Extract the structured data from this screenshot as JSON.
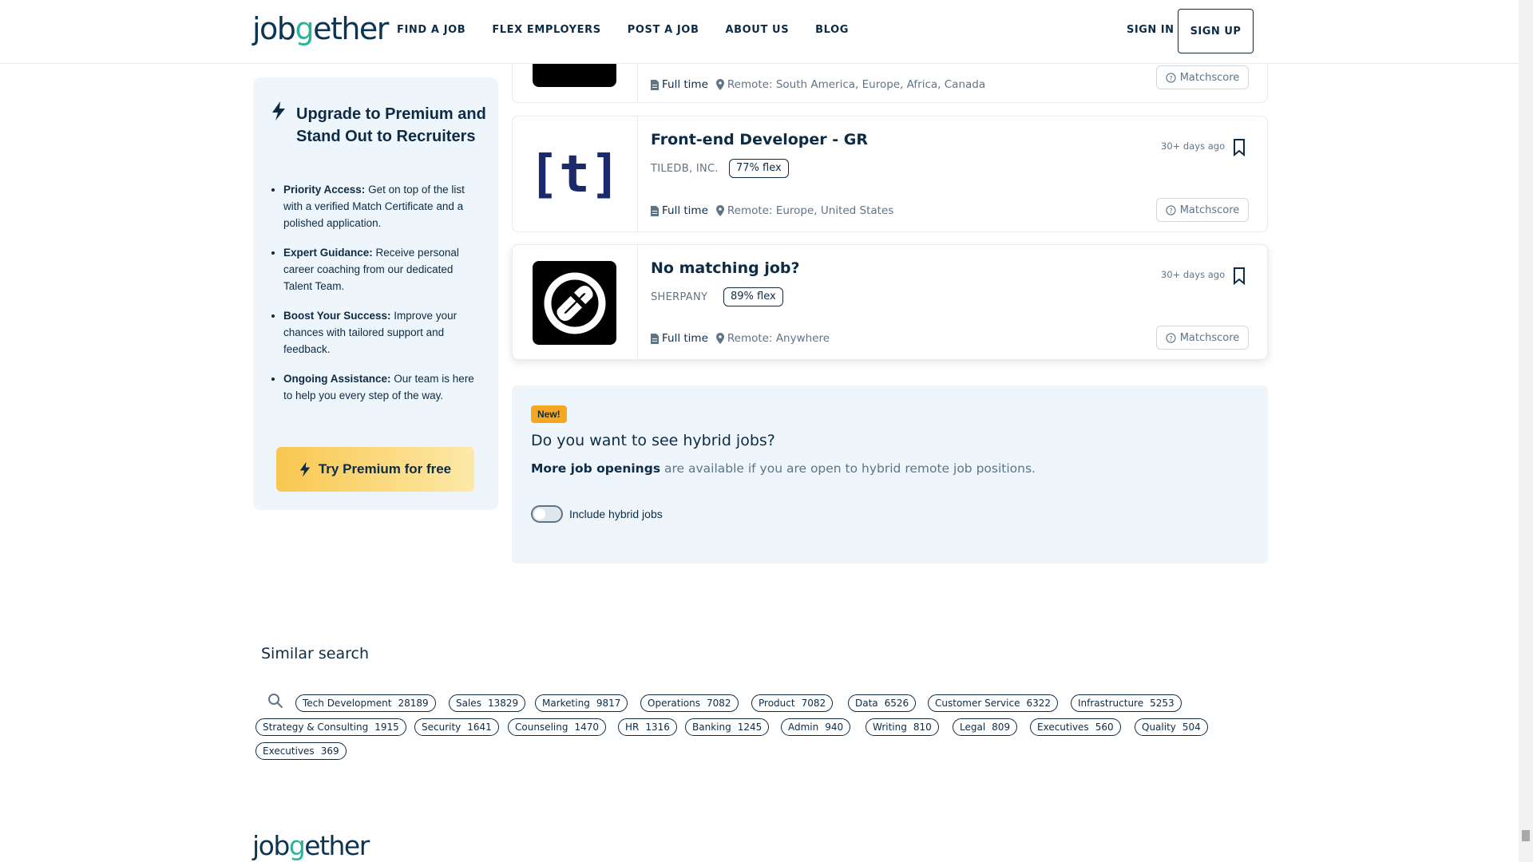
{
  "header": {
    "logo_pre": "job",
    "logo_g": "g",
    "logo_post": "ether",
    "nav": [
      "FIND A JOB",
      "FLEX EMPLOYERS",
      "POST A JOB",
      "ABOUT US",
      "BLOG"
    ],
    "sign_in": "SIGN IN",
    "sign_up": "SIGN UP"
  },
  "premium": {
    "title": "Upgrade to Premium and Stand Out to Recruiters",
    "items": [
      {
        "bold": "Priority Access:",
        "text": " Get on top of the list with a verified Match Certificate and a polished application."
      },
      {
        "bold": "Expert Guidance:",
        "text": " Receive personal career coaching from our dedicated Talent Team."
      },
      {
        "bold": "Boost Your Success:",
        "text": " Improve your chances with tailored support and feedback."
      },
      {
        "bold": "Ongoing Assistance:",
        "text": " Our team is here to help you every step of the way."
      }
    ],
    "cta": "Try Premium for free"
  },
  "jobs": [
    {
      "title": "",
      "company": "",
      "flex": "",
      "type": "Full time",
      "location": "Remote: South America, Europe, Africa, Canada",
      "ago": "",
      "match": "Matchscore"
    },
    {
      "title": "Front-end Developer - GR",
      "company": "TILEDB, INC.",
      "flex": "77% flex",
      "type": "Full time",
      "location": "Remote: Europe, United States",
      "ago": "30+ days ago",
      "match": "Matchscore",
      "logo_text": "[t]"
    },
    {
      "title": "No matching job?",
      "company": "SHERPANY",
      "flex": "89% flex",
      "type": "Full time",
      "location": "Remote: Anywhere",
      "ago": "30+ days ago",
      "match": "Matchscore"
    }
  ],
  "hybrid": {
    "badge": "New!",
    "title": "Do you want to see hybrid jobs?",
    "desc_bold": "More job openings",
    "desc_rest": " are available if you are open to hybrid remote job positions.",
    "toggle_label": "Include hybrid jobs"
  },
  "similar": {
    "title": "Similar search",
    "tags": [
      {
        "label": "Tech Development",
        "count": "28189"
      },
      {
        "label": "Sales",
        "count": "13829"
      },
      {
        "label": "Marketing",
        "count": "9817"
      },
      {
        "label": "Operations",
        "count": "7082"
      },
      {
        "label": "Product",
        "count": "7082"
      },
      {
        "label": "Data",
        "count": "6526"
      },
      {
        "label": "Customer Service",
        "count": "6322"
      },
      {
        "label": "Infrastructure",
        "count": "5253"
      },
      {
        "label": "Strategy & Consulting",
        "count": "1915"
      },
      {
        "label": "Security",
        "count": "1641"
      },
      {
        "label": "Counseling",
        "count": "1470"
      },
      {
        "label": "HR",
        "count": "1316"
      },
      {
        "label": "Banking",
        "count": "1245"
      },
      {
        "label": "Admin",
        "count": "940"
      },
      {
        "label": "Writing",
        "count": "810"
      },
      {
        "label": "Legal",
        "count": "809"
      },
      {
        "label": "Executives",
        "count": "560"
      },
      {
        "label": "Quality",
        "count": "504"
      },
      {
        "label": "Executives",
        "count": "369"
      }
    ]
  },
  "colors": {
    "accent": "#2bb39a",
    "navy": "#0d2b45",
    "premium_bg": "#eef5fb",
    "cta": "#f9c74f",
    "badge": "#f5a623"
  }
}
